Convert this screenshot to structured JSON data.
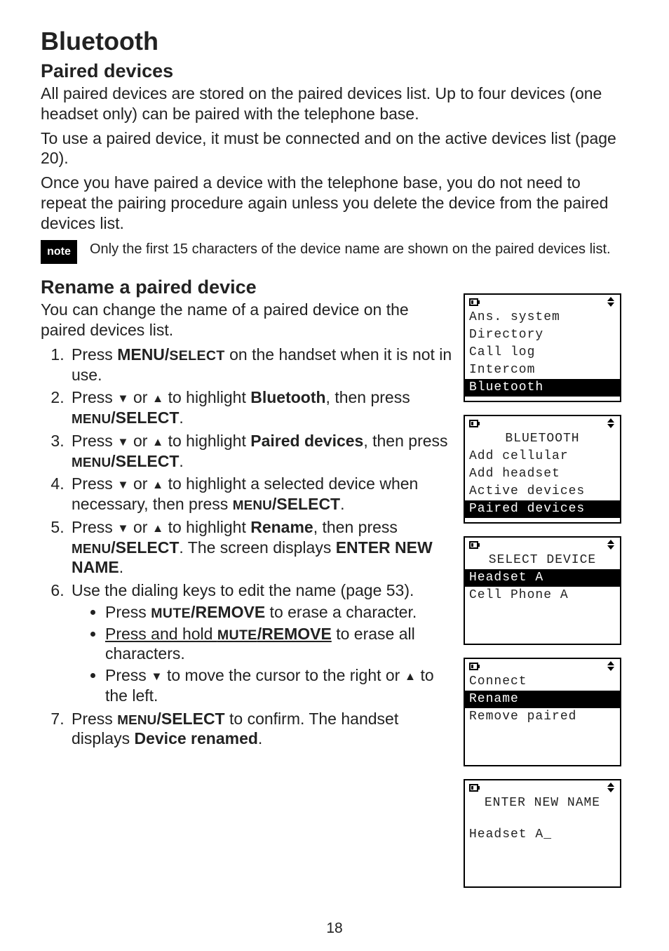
{
  "h1": "Bluetooth",
  "h2a": "Paired devices",
  "p1": "All paired devices are stored on the paired devices list. Up to four devices (one headset only) can be paired with the telephone base.",
  "p2a": "To use a paired device, it must be connected and on the active devices",
  "p2b": "list (page 20).",
  "p3": "Once you have paired a device with the telephone base, you do not need to repeat the pairing procedure again unless you delete the device from the paired devices list.",
  "note_label": "note",
  "note_text": "Only the first 15 characters of the device name are shown on the paired devices list.",
  "h2b": "Rename a paired device",
  "pb1": "You can change the name of a paired device on the paired devices list.",
  "step1_a": "Press ",
  "step1_menu": "MENU/",
  "step1_select_sc": "SELECT",
  "step1_b": " on the handset when it is not in use.",
  "step2_a": "Press ",
  "step2_b": " or ",
  "step2_c": " to highlight ",
  "step2_bt": "Bluetooth",
  "step2_d": ", then press ",
  "step3_c": " to highlight ",
  "step3_pd": "Paired devices",
  "step3_d": ", then press ",
  "step4_c": " to highlight a selected device when necessary, then press ",
  "step5_c": " to highlight ",
  "step5_rn": "Rename",
  "step5_d": ", then press ",
  "step5_e": ". The screen displays ",
  "step5_enn": "ENTER NEW NAME",
  "step5_f": ".",
  "step6": "Use the dialing keys to edit the name (page 53).",
  "b1_a": "Press ",
  "b1_mute": "MUTE",
  "b1_rem": "/REMOVE",
  "b1_b": " to erase a character.",
  "b2_a": "Press and hold ",
  "b2_b": " to erase all characters.",
  "b3_a": "Press ",
  "b3_b": " to move the cursor to the right or ",
  "b3_c": " to the left.",
  "step7_a": "Press ",
  "step7_b": " to confirm. The handset displays ",
  "step7_dr": "Device renamed",
  "step7_c": ".",
  "menu_sc": "MENU",
  "select_big": "/SELECT",
  "lcd1": {
    "l1": "Ans. system",
    "l2": "Directory",
    "l3": "Call log",
    "l4": "Intercom",
    "l5": "Bluetooth"
  },
  "lcd2": {
    "l1": "BLUETOOTH",
    "l2": "Add cellular",
    "l3": "Add headset",
    "l4": "Active devices",
    "l5": "Paired devices"
  },
  "lcd3": {
    "l1": "SELECT DEVICE",
    "l2": "Headset A",
    "l3": "Cell Phone A"
  },
  "lcd4": {
    "l1": "Connect",
    "l2": "Rename",
    "l3": "Remove paired"
  },
  "lcd5": {
    "l1": "ENTER NEW NAME",
    "l2": "Headset A_"
  },
  "page_number": "18",
  "tri_down": "▼",
  "tri_up": "▲"
}
